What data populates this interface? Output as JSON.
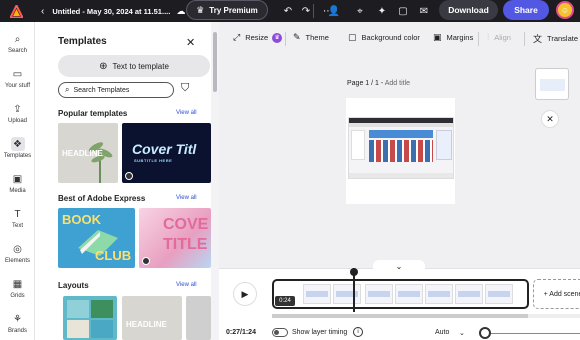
{
  "topbar": {
    "doc_title": "Untitled - May 30, 2024 at 11.51....",
    "premium_label": "Try Premium",
    "download_label": "Download",
    "share_label": "Share",
    "icons": [
      "adobe-express-logo",
      "back-chevron",
      "cloud-icon",
      "crown-icon",
      "undo-icon",
      "redo-icon",
      "more-icon",
      "add-user-icon",
      "pin-icon",
      "lightbulb-icon",
      "comment-icon",
      "gift-icon"
    ]
  },
  "rail": {
    "items": [
      {
        "label": "Search",
        "icon": "search-icon"
      },
      {
        "label": "Your stuff",
        "icon": "folder-icon"
      },
      {
        "label": "Upload",
        "icon": "upload-icon"
      },
      {
        "label": "Templates",
        "icon": "templates-icon",
        "active": true
      },
      {
        "label": "Media",
        "icon": "media-icon"
      },
      {
        "label": "Text",
        "icon": "text-icon"
      },
      {
        "label": "Elements",
        "icon": "elements-icon"
      },
      {
        "label": "Grids",
        "icon": "grids-icon"
      },
      {
        "label": "Brands",
        "icon": "brands-icon"
      }
    ]
  },
  "panel": {
    "title": "Templates",
    "text_to_template": "Text to template",
    "search_placeholder": "Search Templates",
    "sections": [
      {
        "title": "Popular templates",
        "view_all": "View all"
      },
      {
        "title": "Best of Adobe Express",
        "view_all": "View all"
      },
      {
        "title": "Layouts",
        "view_all": "View all"
      }
    ],
    "tiles": {
      "headline": "HEADLINE",
      "cover_title": "Cover Titl",
      "cover_subtitle": "SUBTITLE HERE",
      "book": "BOOK",
      "club": "CLUB",
      "cove": "COVE",
      "title2": "TITLE",
      "headline2": "HEADLINE"
    }
  },
  "toolbar": {
    "resize": "Resize",
    "theme": "Theme",
    "background_color": "Background color",
    "margins": "Margins",
    "align": "Align",
    "translate": "Translate"
  },
  "canvas": {
    "page_label": "Page 1 / 1 - ",
    "add_title": "Add title"
  },
  "timeline": {
    "duration_badge": "0:24",
    "add_scene": "+ Add scene",
    "time": "0:27/1:24",
    "show_layer_timing": "Show layer timing",
    "auto": "Auto",
    "playhead_progress": 0.32
  },
  "colors": {
    "topbar_bg": "#1c1c21",
    "share": "#5258e4",
    "link": "#2b4fd6"
  }
}
